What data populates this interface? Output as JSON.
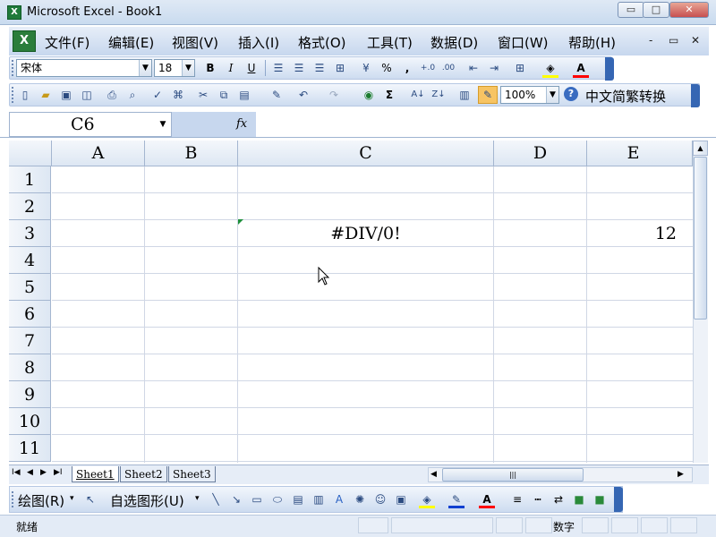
{
  "window": {
    "title": "Microsoft Excel - Book1",
    "min_glyph": "▭",
    "max_glyph": "□",
    "close_glyph": "✕",
    "app_glyph": "X"
  },
  "menu": {
    "items": [
      "文件(F)",
      "编辑(E)",
      "视图(V)",
      "插入(I)",
      "格式(O)",
      "工具(T)",
      "数据(D)",
      "窗口(W)",
      "帮助(H)"
    ],
    "doc_minimize": "-",
    "doc_restore": "▭",
    "doc_close": "✕"
  },
  "format_toolbar": {
    "font_name": "宋体",
    "font_size": "18",
    "bold": "B",
    "italic": "I",
    "underline": "U",
    "percent": "%",
    "comma": ","
  },
  "standard_toolbar": {
    "zoom": "100%",
    "chinese_convert": "中文简繁转换",
    "sigma": "Σ",
    "help": "?"
  },
  "formula_bar": {
    "name_box": "C6",
    "fx": "fx",
    "formula": ""
  },
  "grid": {
    "columns": [
      "A",
      "B",
      "C",
      "D",
      "E"
    ],
    "rows": [
      "1",
      "2",
      "3",
      "4",
      "5",
      "6",
      "7",
      "8",
      "9",
      "10",
      "11"
    ],
    "cells": {
      "C3": "#DIV/0!",
      "E3": "12"
    }
  },
  "sheets": [
    "Sheet1",
    "Sheet2",
    "Sheet3"
  ],
  "drawing_toolbar": {
    "draw": "绘图(R)",
    "autoshapes": "自选图形(U)"
  },
  "status": {
    "ready": "就绪",
    "num": "数字"
  }
}
